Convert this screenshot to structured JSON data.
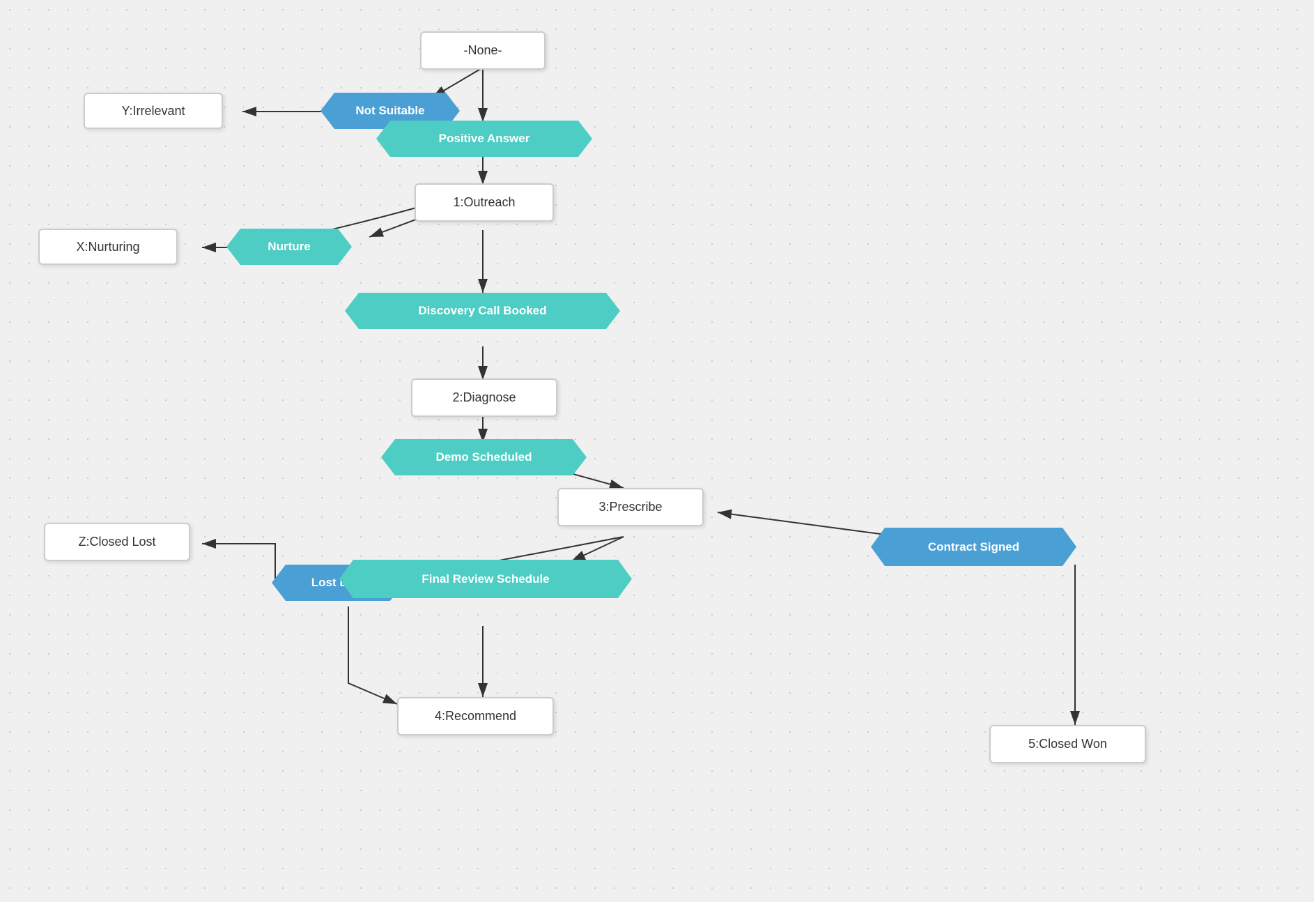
{
  "nodes": {
    "none": {
      "label": "-None-"
    },
    "not_suitable": {
      "label": "Not Suitable"
    },
    "positive_answer": {
      "label": "Positive Answer"
    },
    "y_irrelevant": {
      "label": "Y:Irrelevant"
    },
    "outreach": {
      "label": "1:Outreach"
    },
    "nurture": {
      "label": "Nurture"
    },
    "x_nurturing": {
      "label": "X:Nurturing"
    },
    "discovery_call": {
      "label": "Discovery Call Booked"
    },
    "diagnose": {
      "label": "2:Diagnose"
    },
    "demo_scheduled": {
      "label": "Demo Scheduled"
    },
    "prescribe": {
      "label": "3:Prescribe"
    },
    "contract_signed": {
      "label": "Contract Signed"
    },
    "lost_deal": {
      "label": "Lost Deal"
    },
    "z_closed_lost": {
      "label": "Z:Closed Lost"
    },
    "final_review": {
      "label": "Final Review Schedule"
    },
    "recommend": {
      "label": "4:Recommend"
    },
    "closed_won": {
      "label": "5:Closed Won"
    }
  }
}
